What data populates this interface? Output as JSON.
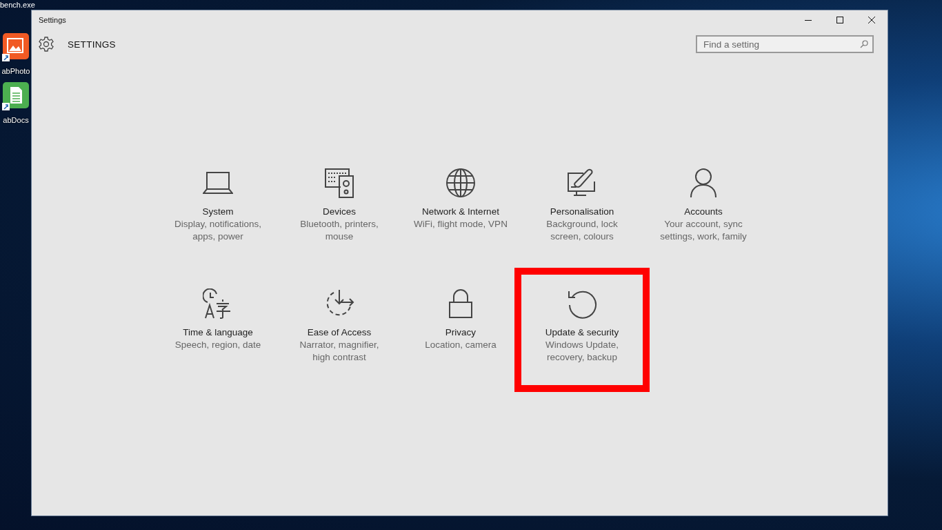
{
  "background_window_title": "bench.exe",
  "desktop_icons": [
    {
      "kind": "photo",
      "label": "abPhoto"
    },
    {
      "kind": "document",
      "label": "abDocs"
    }
  ],
  "window": {
    "title": "Settings",
    "heading": "SETTINGS",
    "search": {
      "placeholder": "Find a setting"
    }
  },
  "tiles": [
    {
      "kind": "system",
      "title": "System",
      "description_lines": [
        "Display, notifications,",
        "apps, power"
      ],
      "highlighted": false
    },
    {
      "kind": "devices",
      "title": "Devices",
      "description_lines": [
        "Bluetooth, printers,",
        "mouse"
      ],
      "highlighted": false
    },
    {
      "kind": "network",
      "title": "Network & Internet",
      "description_lines": [
        "WiFi, flight mode, VPN"
      ],
      "highlighted": false
    },
    {
      "kind": "personalisation",
      "title": "Personalisation",
      "description_lines": [
        "Background, lock",
        "screen, colours"
      ],
      "highlighted": false
    },
    {
      "kind": "accounts",
      "title": "Accounts",
      "description_lines": [
        "Your account, sync",
        "settings, work, family"
      ],
      "highlighted": false
    },
    {
      "kind": "time",
      "title": "Time & language",
      "description_lines": [
        "Speech, region, date"
      ],
      "highlighted": false
    },
    {
      "kind": "ease",
      "title": "Ease of Access",
      "description_lines": [
        "Narrator, magnifier,",
        "high contrast"
      ],
      "highlighted": false
    },
    {
      "kind": "privacy",
      "title": "Privacy",
      "description_lines": [
        "Location, camera"
      ],
      "highlighted": false
    },
    {
      "kind": "update",
      "title": "Update & security",
      "description_lines": [
        "Windows Update,",
        "recovery, backup"
      ],
      "highlighted": true
    }
  ]
}
